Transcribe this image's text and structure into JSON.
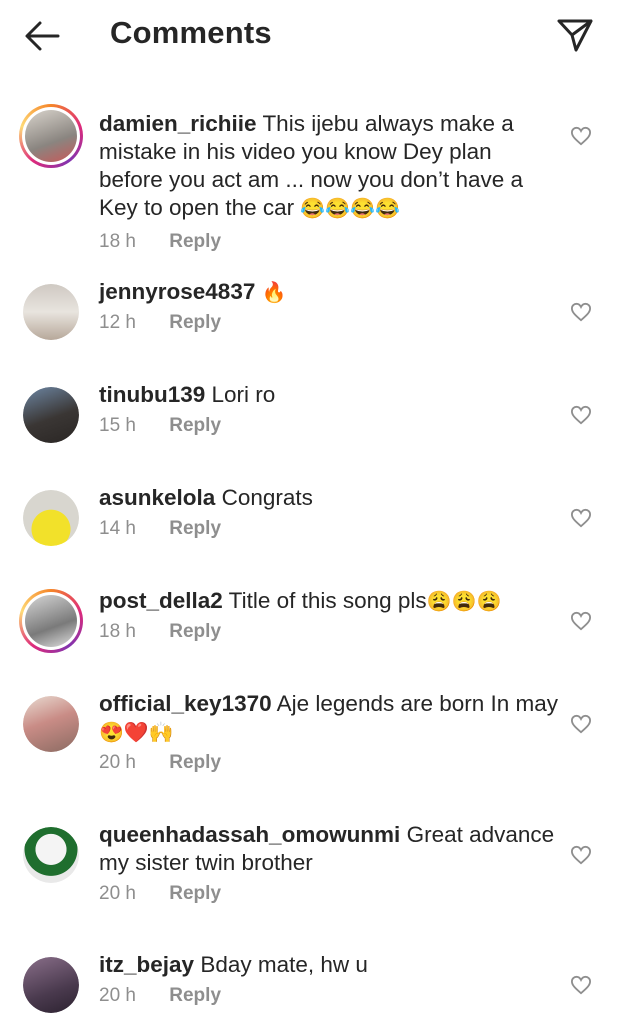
{
  "header": {
    "title": "Comments",
    "back_icon": "arrow-left-icon",
    "share_icon": "paper-plane-icon"
  },
  "comments": [
    {
      "username": "damien_richiie",
      "text": "This ijebu always make a mistake in his video you know Dey plan before you act am ... now you don’t have a Key to open the car",
      "emoji": "😂😂😂😂",
      "time": "18 h",
      "reply": "Reply"
    },
    {
      "username": "jennyrose4837",
      "text": "",
      "emoji": "🔥",
      "time": "12 h",
      "reply": "Reply"
    },
    {
      "username": "tinubu139",
      "text": "Lori ro",
      "emoji": "",
      "time": "15 h",
      "reply": "Reply"
    },
    {
      "username": "asunkelola",
      "text": "Congrats",
      "emoji": "",
      "time": "14 h",
      "reply": "Reply"
    },
    {
      "username": "post_della2",
      "text": "Title of this song pls",
      "emoji": "😩😩😩",
      "time": "18 h",
      "reply": "Reply"
    },
    {
      "username": "official_key1370",
      "text": "Aje legends are born In may",
      "emoji": "😍❤️🙌",
      "time": "20 h",
      "reply": "Reply"
    },
    {
      "username": "queenhadassah_omowunmi",
      "text": "Great advance my sister twin brother",
      "emoji": "",
      "time": "20 h",
      "reply": "Reply"
    },
    {
      "username": "itz_bejay",
      "text": "Bday mate, hw u",
      "emoji": "",
      "time": "20 h",
      "reply": "Reply"
    }
  ],
  "colors": {
    "text": "#262626",
    "meta": "#8e8e8e",
    "story_ring": "#dd2a7b"
  }
}
